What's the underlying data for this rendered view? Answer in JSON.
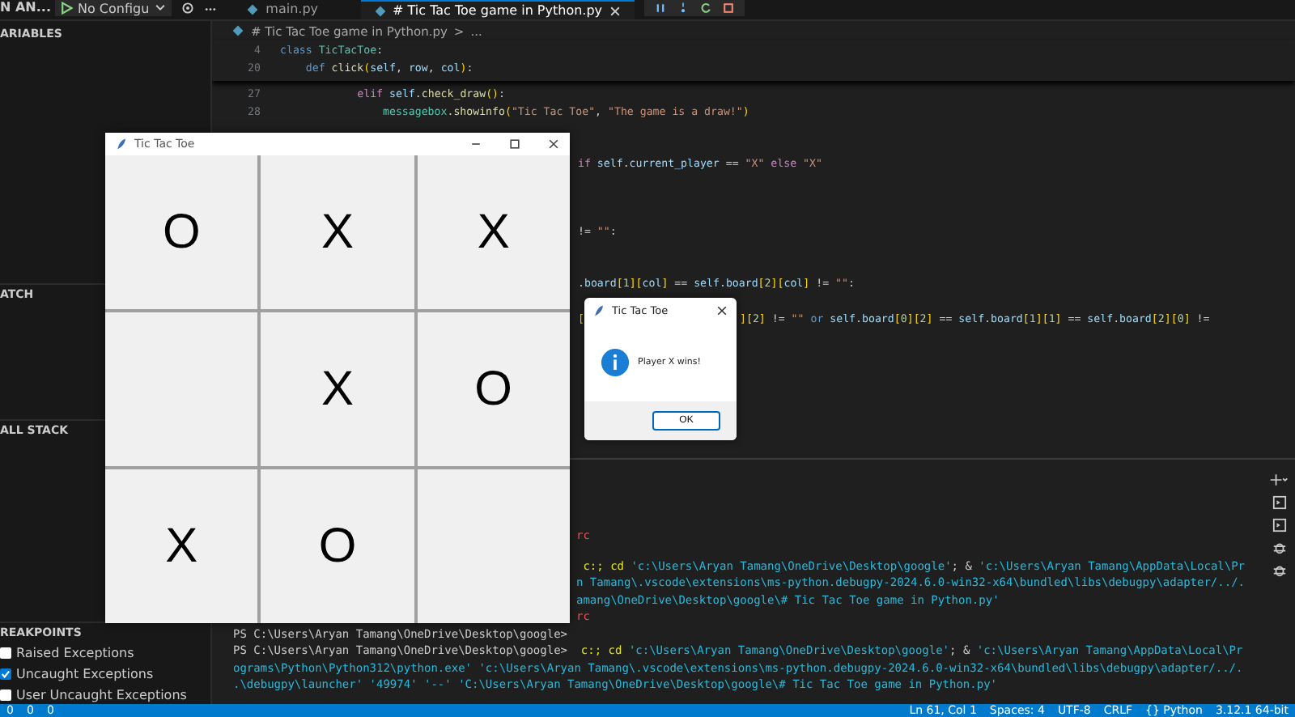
{
  "top_bar": {
    "run_label": "N AN...",
    "config": "No Configu",
    "tabs": [
      {
        "label": "main.py",
        "selected": false
      },
      {
        "label": "# Tic Tac Toe game in Python.py",
        "selected": true
      }
    ]
  },
  "sidebar": {
    "sections": [
      {
        "title": "ARIABLES"
      },
      {
        "title": "ATCH"
      },
      {
        "title": "ALL STACK"
      },
      {
        "title": "REAKPOINTS",
        "items": [
          {
            "label": "Raised Exceptions",
            "checked": false
          },
          {
            "label": "Uncaught Exceptions",
            "checked": true
          },
          {
            "label": "User Uncaught Exceptions",
            "checked": false
          }
        ]
      }
    ]
  },
  "breadcrumb": [
    "# Tic Tac Toe game in Python.py",
    ">",
    "..."
  ],
  "sticky_lines": [
    {
      "num": "4",
      "tokens": [
        {
          "t": "class ",
          "kind": "kwb"
        },
        {
          "t": "TicTacToe",
          "kind": "cls"
        },
        {
          "t": ":",
          "kind": "p"
        }
      ]
    },
    {
      "num": "20",
      "tokens": [
        {
          "t": "    def ",
          "kind": "kwb"
        },
        {
          "t": "click",
          "kind": "fn"
        },
        {
          "t": "(",
          "kind": "br"
        },
        {
          "t": "self",
          "kind": "var"
        },
        {
          "t": ", ",
          "kind": "p"
        },
        {
          "t": "row",
          "kind": "var"
        },
        {
          "t": ", ",
          "kind": "p"
        },
        {
          "t": "col",
          "kind": "var"
        },
        {
          "t": ")",
          "kind": "br"
        },
        {
          "t": ":",
          "kind": "p"
        }
      ]
    }
  ],
  "code_lines": [
    {
      "num": "27",
      "tokens": [
        {
          "t": "            elif ",
          "kind": "kw"
        },
        {
          "t": "self",
          "kind": "var"
        },
        {
          "t": ".",
          "kind": "p"
        },
        {
          "t": "check_draw",
          "kind": "fn"
        },
        {
          "t": "()",
          "kind": "br"
        },
        {
          "t": ":",
          "kind": "p"
        }
      ]
    },
    {
      "num": "28",
      "tokens": [
        {
          "t": "                messagebox",
          "kind": "cls"
        },
        {
          "t": ".showinfo",
          "kind": "fn"
        },
        {
          "t": "(",
          "kind": "br"
        },
        {
          "t": "\"Tic Tac Toe\"",
          "kind": "str"
        },
        {
          "t": ", ",
          "kind": "p"
        },
        {
          "t": "\"The game is a draw!\"",
          "kind": "str"
        },
        {
          "t": ")",
          "kind": "br"
        }
      ]
    }
  ],
  "code_fragments": [
    [
      [
        {
          "t": "if ",
          "kind": "kw"
        },
        {
          "t": "self",
          "kind": "var"
        },
        {
          "t": ".",
          "kind": "p"
        },
        {
          "t": "current_player",
          "kind": "var"
        },
        {
          "t": " == ",
          "kind": "p"
        },
        {
          "t": "\"X\"",
          "kind": "str"
        },
        {
          "t": " else ",
          "kind": "kw"
        },
        {
          "t": "\"X\"",
          "kind": "str"
        }
      ]
    ],
    [
      [
        {
          "t": "!= ",
          "kind": "p"
        },
        {
          "t": "\"\"",
          "kind": "str"
        },
        {
          "t": ":",
          "kind": "p"
        }
      ]
    ],
    [
      [
        {
          "t": ".",
          "kind": "p"
        },
        {
          "t": "board",
          "kind": "var"
        },
        {
          "t": "[",
          "kind": "br"
        },
        {
          "t": "1",
          "kind": "num"
        },
        {
          "t": "][",
          "kind": "br"
        },
        {
          "t": "col",
          "kind": "var"
        },
        {
          "t": "]",
          "kind": "br"
        },
        {
          "t": " == ",
          "kind": "p"
        },
        {
          "t": "self",
          "kind": "var"
        },
        {
          "t": ".",
          "kind": "p"
        },
        {
          "t": "board",
          "kind": "var"
        },
        {
          "t": "[",
          "kind": "br"
        },
        {
          "t": "2",
          "kind": "num"
        },
        {
          "t": "][",
          "kind": "br"
        },
        {
          "t": "col",
          "kind": "var"
        },
        {
          "t": "]",
          "kind": "br"
        },
        {
          "t": " != ",
          "kind": "p"
        },
        {
          "t": "\"\"",
          "kind": "str"
        },
        {
          "t": ":",
          "kind": "p"
        }
      ]
    ],
    [
      [
        {
          "t": "[",
          "kind": "br"
        }
      ],
      [
        {
          "t": "][",
          "kind": "br"
        },
        {
          "t": "2",
          "kind": "num"
        },
        {
          "t": "]",
          "kind": "br"
        },
        {
          "t": " != ",
          "kind": "p"
        },
        {
          "t": "\"\"",
          "kind": "str"
        },
        {
          "t": " or ",
          "kind": "kwb"
        },
        {
          "t": "self",
          "kind": "var"
        },
        {
          "t": ".",
          "kind": "p"
        },
        {
          "t": "board",
          "kind": "var"
        },
        {
          "t": "[",
          "kind": "br"
        },
        {
          "t": "0",
          "kind": "num"
        },
        {
          "t": "][",
          "kind": "br"
        },
        {
          "t": "2",
          "kind": "num"
        },
        {
          "t": "]",
          "kind": "br"
        },
        {
          "t": " == ",
          "kind": "p"
        },
        {
          "t": "self",
          "kind": "var"
        },
        {
          "t": ".",
          "kind": "p"
        },
        {
          "t": "board",
          "kind": "var"
        },
        {
          "t": "[",
          "kind": "br"
        },
        {
          "t": "1",
          "kind": "num"
        },
        {
          "t": "][",
          "kind": "br"
        },
        {
          "t": "1",
          "kind": "num"
        },
        {
          "t": "]",
          "kind": "br"
        },
        {
          "t": " == ",
          "kind": "p"
        },
        {
          "t": "self",
          "kind": "var"
        },
        {
          "t": ".",
          "kind": "p"
        },
        {
          "t": "board",
          "kind": "var"
        },
        {
          "t": "[",
          "kind": "br"
        },
        {
          "t": "2",
          "kind": "num"
        },
        {
          "t": "][",
          "kind": "br"
        },
        {
          "t": "0",
          "kind": "num"
        },
        {
          "t": "]",
          "kind": "br"
        },
        {
          "t": " !=",
          "kind": "p"
        }
      ]
    ]
  ],
  "terminal_lines": [
    {
      "kind": "partial",
      "tokens": [
        {
          "t": "rc",
          "kind": "err"
        }
      ]
    },
    {
      "kind": "partial",
      "tokens": [
        {
          "t": " c:; cd ",
          "kind": "cmd"
        },
        {
          "t": "'c:\\Users\\Aryan Tamang\\OneDrive\\Desktop\\google'",
          "kind": "path"
        },
        {
          "t": "; & ",
          "kind": "plain"
        },
        {
          "t": "'c:\\Users\\Aryan Tamang\\AppData\\Local\\Pr",
          "kind": "path"
        }
      ]
    },
    {
      "kind": "partial",
      "tokens": [
        {
          "t": "n Tamang\\.vscode\\extensions\\ms-python.debugpy-2024.6.0-win32-x64\\bundled\\libs\\debugpy\\adapter/../.",
          "kind": "path"
        }
      ]
    },
    {
      "kind": "partial",
      "tokens": [
        {
          "t": "amang\\OneDrive\\Desktop\\google\\# Tic Tac Toe game in Python.py'",
          "kind": "path"
        }
      ]
    },
    {
      "kind": "partial",
      "tokens": [
        {
          "t": "rc",
          "kind": "err"
        }
      ]
    },
    {
      "kind": "full",
      "tokens": [
        {
          "t": "PS C:\\Users\\Aryan Tamang\\OneDrive\\Desktop\\google>",
          "kind": "plain"
        }
      ]
    },
    {
      "kind": "full",
      "tokens": [
        {
          "t": "PS C:\\Users\\Aryan Tamang\\OneDrive\\Desktop\\google> ",
          "kind": "plain"
        },
        {
          "t": " c:; cd ",
          "kind": "cmd"
        },
        {
          "t": "'c:\\Users\\Aryan Tamang\\OneDrive\\Desktop\\google'",
          "kind": "path"
        },
        {
          "t": "; & ",
          "kind": "plain"
        },
        {
          "t": "'c:\\Users\\Aryan Tamang\\AppData\\Local\\Pr",
          "kind": "path"
        }
      ]
    },
    {
      "kind": "full",
      "tokens": [
        {
          "t": "ograms\\Python\\Python312\\python.exe' 'c:\\Users\\Aryan Tamang\\.vscode\\extensions\\ms-python.debugpy-2024.6.0-win32-x64\\bundled\\libs\\debugpy\\adapter/../.",
          "kind": "path"
        }
      ]
    },
    {
      "kind": "full",
      "tokens": [
        {
          "t": ".\\debugpy\\launcher' '49974' '--' 'C:\\Users\\Aryan Tamang\\OneDrive\\Desktop\\google\\# Tic Tac Toe game in Python.py'",
          "kind": "path"
        }
      ]
    }
  ],
  "status_bar": {
    "counts": [
      "0",
      "0",
      "0"
    ],
    "items": [
      "Ln 61, Col 1",
      "Spaces: 4",
      "UTF-8",
      "CRLF",
      "{} Python",
      "3.12.1 64-bit"
    ]
  },
  "game_window": {
    "title": "Tic Tac Toe",
    "cells": [
      {
        "mark": "O"
      },
      {
        "mark": "X"
      },
      {
        "mark": "X"
      },
      {},
      {
        "mark": "X"
      },
      {
        "mark": "O"
      },
      {
        "mark": "X"
      },
      {
        "mark": "O"
      },
      {}
    ]
  },
  "dialog": {
    "title": "Tic Tac Toe",
    "message": "Player X wins!",
    "button": "OK"
  }
}
